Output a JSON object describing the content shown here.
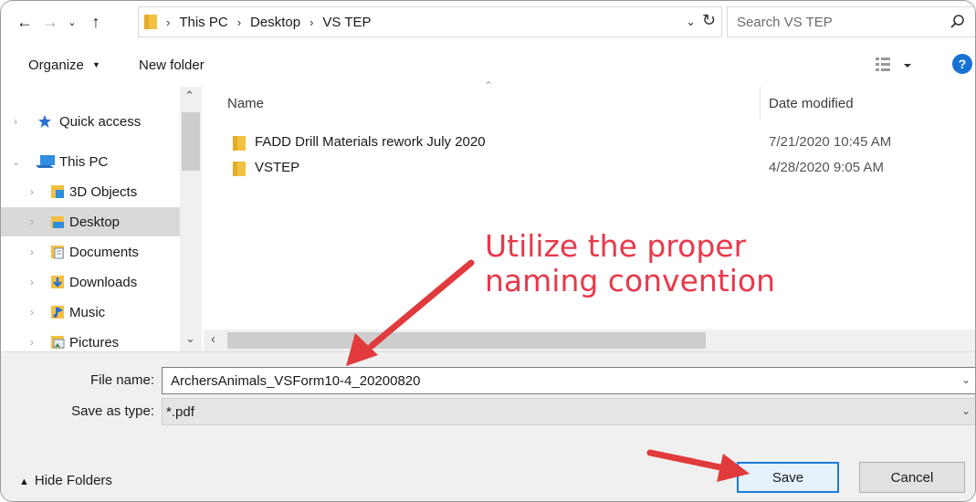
{
  "address": {
    "crumbs": [
      "This PC",
      "Desktop",
      "VS TEP"
    ],
    "search_placeholder": "Search VS TEP"
  },
  "toolbar": {
    "organize_label": "Organize",
    "new_folder_label": "New folder"
  },
  "nav": {
    "quick_access": "Quick access",
    "this_pc": "This PC",
    "items": [
      {
        "label": "3D Objects",
        "icon": "3d-objects-icon"
      },
      {
        "label": "Desktop",
        "icon": "desktop-folder-icon",
        "selected": true
      },
      {
        "label": "Documents",
        "icon": "documents-icon"
      },
      {
        "label": "Downloads",
        "icon": "downloads-icon"
      },
      {
        "label": "Music",
        "icon": "music-icon"
      },
      {
        "label": "Pictures",
        "icon": "pictures-icon"
      }
    ]
  },
  "list": {
    "col_name": "Name",
    "col_date": "Date modified",
    "rows": [
      {
        "name": "FADD Drill Materials rework July 2020",
        "date": "7/21/2020 10:45 AM"
      },
      {
        "name": "VSTEP",
        "date": "4/28/2020 9:05 AM"
      }
    ]
  },
  "annotation": {
    "line1": "Utilize the proper",
    "line2": "naming convention",
    "color": "#e8394a"
  },
  "form": {
    "file_name_label": "File name:",
    "file_name_value": "ArchersAnimals_VSForm10-4_20200820",
    "save_type_label": "Save as type:",
    "save_type_value": "*.pdf"
  },
  "footer": {
    "hide_folders": "Hide Folders",
    "save": "Save",
    "cancel": "Cancel"
  },
  "colors": {
    "accent": "#1c7bd9",
    "folder": "#f3c041",
    "arrow": "#e03a3c"
  }
}
